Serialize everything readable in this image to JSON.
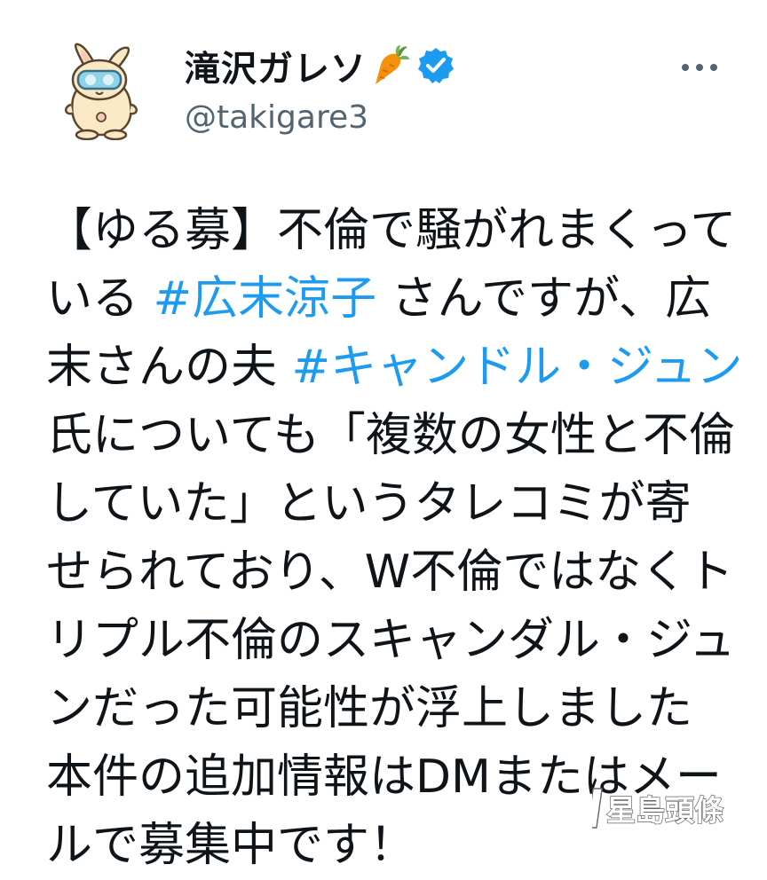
{
  "account": {
    "display_name": "滝沢ガレソ",
    "handle": "@takigare3",
    "name_emoji_icon": "carrot-icon",
    "verified_icon": "verified-badge-icon",
    "avatar_icon": "rabbit-mascot-avatar",
    "more_icon": "more-options-icon"
  },
  "tweet": {
    "lines": [
      [
        {
          "text": "【ゆる募】不倫で騒がれまくって"
        }
      ],
      [
        {
          "text": "いる "
        },
        {
          "text": "#広末涼子",
          "hashtag": true
        },
        {
          "text": " さんですが、広"
        }
      ],
      [
        {
          "text": "末さんの夫 "
        },
        {
          "text": "#キャンドル・ジュン",
          "hashtag": true
        }
      ],
      [
        {
          "text": "氏についても「複数の女性と不倫"
        }
      ],
      [
        {
          "text": "していた」というタレコミが寄"
        }
      ],
      [
        {
          "text": "せられており、W不倫ではなくト"
        }
      ],
      [
        {
          "text": "リプル不倫のスキャンダル・ジュ"
        }
      ],
      [
        {
          "text": "ンだった可能性が浮上しました"
        }
      ],
      [
        {
          "text": "本件の追加情報はDMまたはメー"
        }
      ],
      [
        {
          "text": "ルで募集中です！"
        }
      ]
    ]
  },
  "watermark": {
    "text": "星島頭條"
  },
  "colors": {
    "text": "#0f1419",
    "secondary": "#536471",
    "link": "#1d9bf0",
    "verified": "#1d9bf0",
    "background": "#ffffff"
  }
}
